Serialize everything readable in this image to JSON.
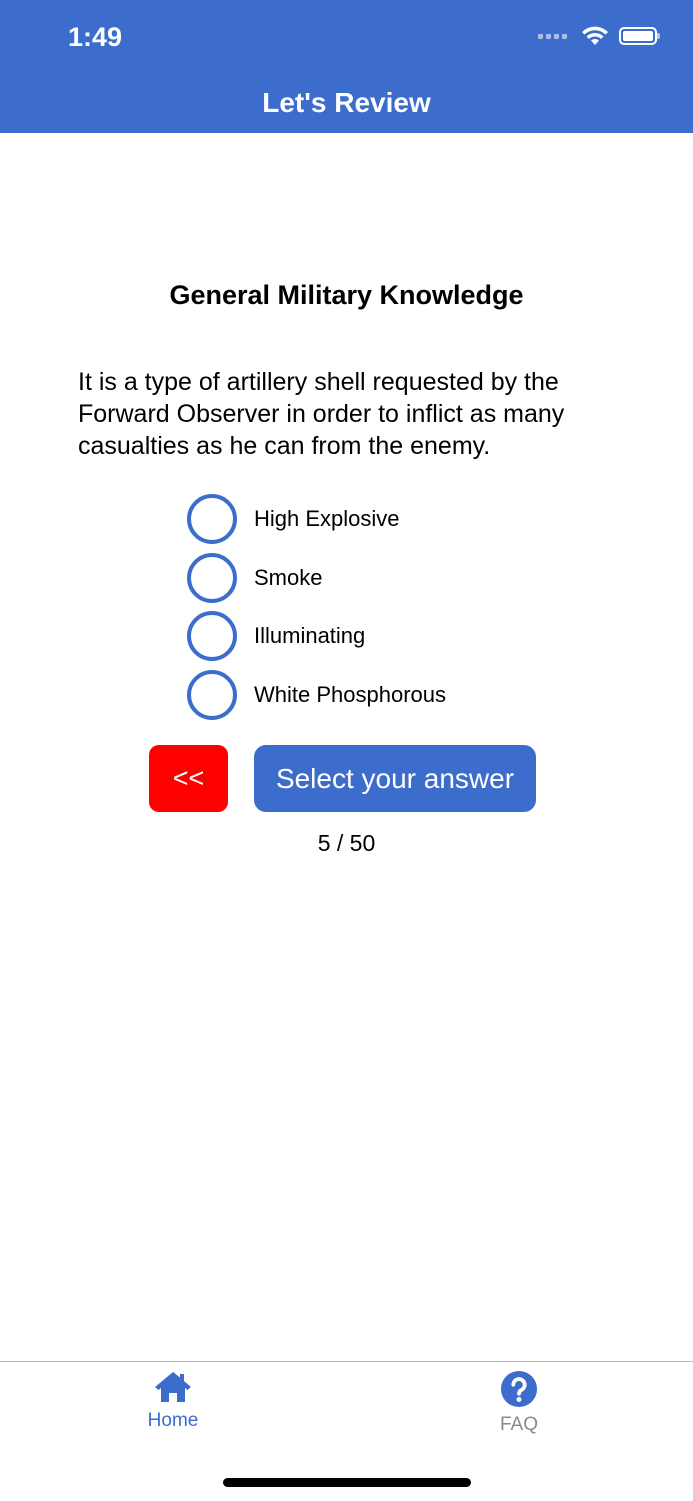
{
  "status_bar": {
    "time": "1:49"
  },
  "nav": {
    "title": "Let's Review"
  },
  "quiz": {
    "category": "General Military Knowledge",
    "question": "It is a type of artillery shell requested by the Forward Observer in order to inflict as many casualties as he can from the enemy.",
    "options": [
      {
        "label": "High Explosive"
      },
      {
        "label": "Smoke"
      },
      {
        "label": "Illuminating"
      },
      {
        "label": "White Phosphorous"
      }
    ],
    "back_label": "<<",
    "submit_label": "Select your answer",
    "progress": "5 / 50"
  },
  "tabbar": {
    "home": {
      "label": "Home",
      "icon": "home-icon"
    },
    "faq": {
      "label": "FAQ",
      "icon": "question-circle-icon"
    }
  },
  "colors": {
    "primary": "#3d6dcc",
    "back_button": "#ff0000",
    "inactive_tab": "#8a8a8a"
  }
}
